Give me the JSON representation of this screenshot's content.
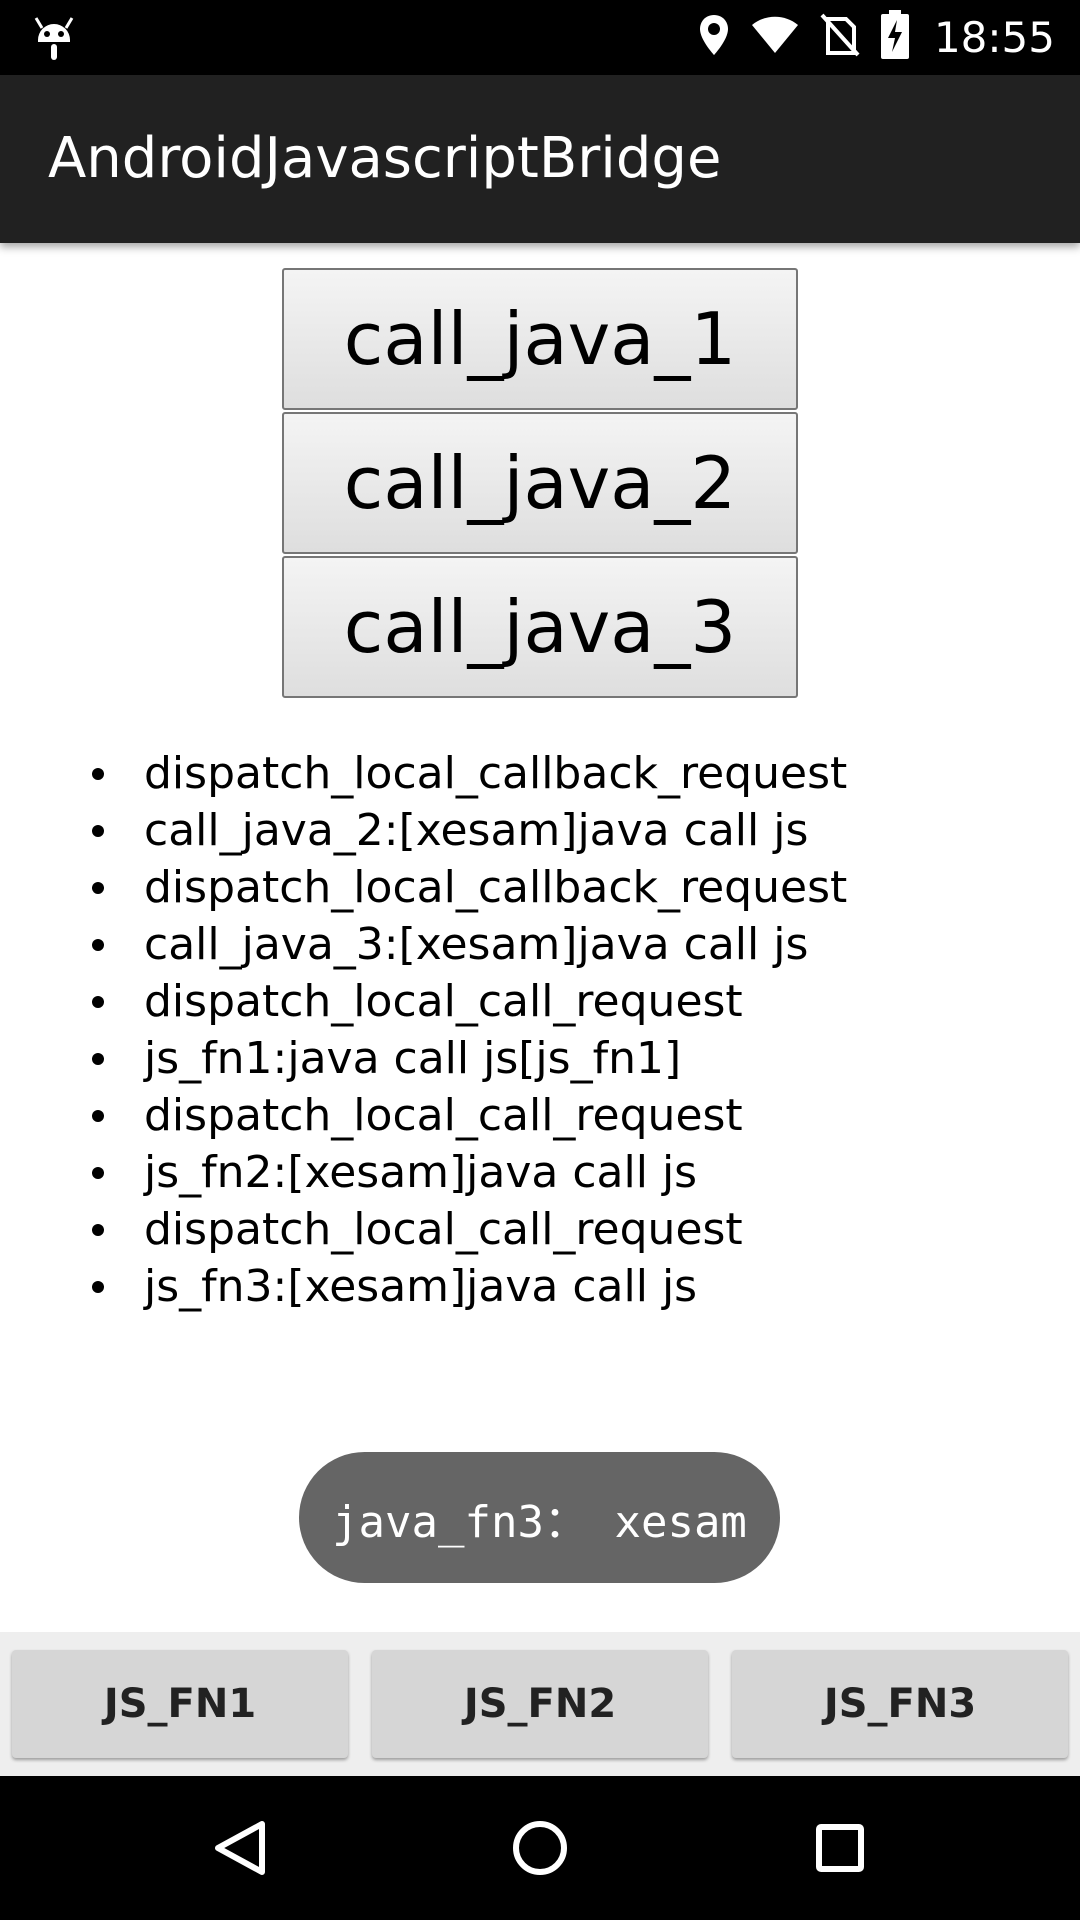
{
  "status_bar": {
    "time": "18:55",
    "icons": [
      "android-debug-icon",
      "location-icon",
      "wifi-icon",
      "no-sim-icon",
      "battery-charging-icon"
    ]
  },
  "app_bar": {
    "title": "AndroidJavascriptBridge"
  },
  "web_buttons": [
    {
      "label": "call_java_1"
    },
    {
      "label": "call_java_2"
    },
    {
      "label": "call_java_3"
    }
  ],
  "log": [
    "dispatch_local_callback_request",
    "call_java_2:[xesam]java call js",
    "dispatch_local_callback_request",
    "call_java_3:[xesam]java call js",
    "dispatch_local_call_request",
    "js_fn1:java call js[js_fn1]",
    "dispatch_local_call_request",
    "js_fn2:[xesam]java call js",
    "dispatch_local_call_request",
    "js_fn3:[xesam]java call js"
  ],
  "toast": {
    "text": "java_fn3： xesam"
  },
  "native_buttons": [
    {
      "label": "JS_FN1"
    },
    {
      "label": "JS_FN2"
    },
    {
      "label": "JS_FN3"
    }
  ],
  "nav_bar": {
    "icons": [
      "back-icon",
      "home-icon",
      "recents-icon"
    ]
  },
  "colors": {
    "app_bar": "#212121",
    "status_bar": "#000000",
    "toast_bg": "#656565",
    "bottom_panel": "#eeeeee",
    "native_button": "#d6d6d6"
  }
}
